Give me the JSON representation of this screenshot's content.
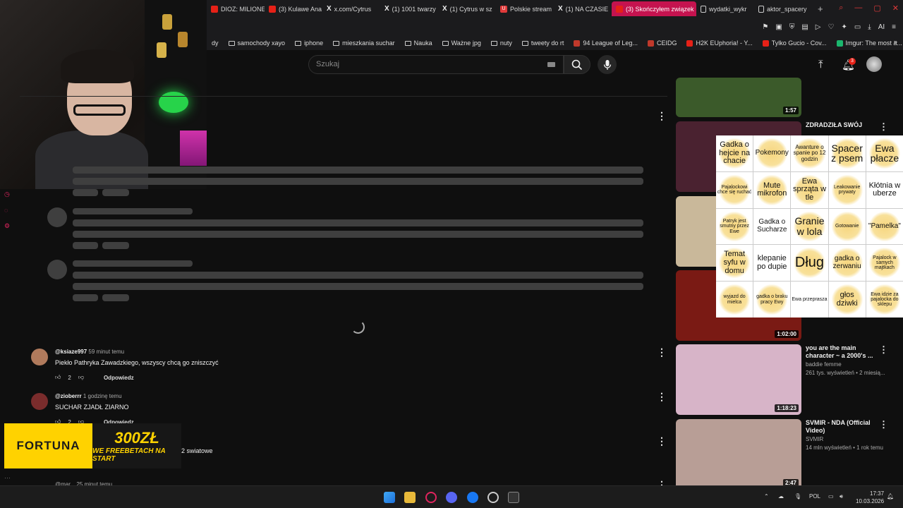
{
  "browser": {
    "tabs": [
      {
        "label": "DIOZ: MILIONE",
        "icon": "youtube-icon"
      },
      {
        "label": "(3) Kulawe Ana",
        "icon": "youtube-icon"
      },
      {
        "label": "x.com/Cytrus",
        "icon": "x-icon"
      },
      {
        "label": "(1) 1001 twarzy",
        "icon": "x-icon"
      },
      {
        "label": "(1) Cytrus w sz",
        "icon": "x-icon"
      },
      {
        "label": "Polskie stream",
        "icon": "u-icon"
      },
      {
        "label": "(1) NA CZASIE",
        "icon": "x-icon"
      },
      {
        "label": "(3) Skończyłem związek",
        "icon": "youtube-icon",
        "active": true
      },
      {
        "label": "wydatki_wykr",
        "icon": "doc-icon"
      },
      {
        "label": "aktor_spacery",
        "icon": "doc-icon"
      }
    ],
    "new_tab": "+",
    "toolbar_ai": "AI",
    "bookmarks": [
      {
        "label": "dy",
        "icon": ""
      },
      {
        "label": "samochody xayo",
        "icon": "folder-icon"
      },
      {
        "label": "iphone",
        "icon": "folder-icon"
      },
      {
        "label": "mieszkania suchar",
        "icon": "folder-icon"
      },
      {
        "label": "Nauka",
        "icon": "folder-icon"
      },
      {
        "label": "Ważne jpg",
        "icon": "folder-icon"
      },
      {
        "label": "nuty",
        "icon": "folder-icon"
      },
      {
        "label": "tweety do rt",
        "icon": "folder-icon"
      },
      {
        "label": "94 League of Leg...",
        "icon": "lol-icon"
      },
      {
        "label": "CEIDG",
        "icon": "ceidg-icon"
      },
      {
        "label": "H2K EUphoria! - Y...",
        "icon": "youtube-icon"
      },
      {
        "label": "Tylko Gucio - Cov...",
        "icon": "youtube-icon"
      },
      {
        "label": "Imgur: The most a...",
        "icon": "imgur-icon"
      }
    ]
  },
  "youtube": {
    "search_placeholder": "Szukaj",
    "notifications_count": "3"
  },
  "comments": [
    {
      "user": "@ksiaze997",
      "time": "59 minut temu",
      "text": "Piekło Pathryka Zawadzkiego, wszyscy chcą go zniszczyć",
      "likes": "2",
      "reply": "Odpowiedz",
      "avatar_color": "#b07a5c"
    },
    {
      "user": "@zioberrr",
      "time": "1 godzinę temu",
      "text": "SUCHAR ZJADŁ ZIARNO",
      "likes": "2",
      "reply": "Odpowiedz",
      "avatar_color": "#7a2c2c"
    },
    {
      "user": "",
      "time": "",
      "text": "2 swiatowe",
      "likes": "",
      "reply": "",
      "avatar_color": "#444"
    },
    {
      "user": "@mar...",
      "time": "25 minut temu",
      "text": "",
      "likes": "",
      "reply": "",
      "avatar_color": "#444"
    }
  ],
  "related": [
    {
      "title": "",
      "channel": "",
      "meta": "",
      "duration": "1:57",
      "thumb": "#3b5a2a"
    },
    {
      "title": "ZDRADZIŁA SWÓJ",
      "channel": "",
      "meta": "",
      "duration": "",
      "thumb": "#4a2230"
    },
    {
      "title": "",
      "channel": "",
      "meta": "",
      "duration": "",
      "thumb": "#c9b89a"
    },
    {
      "title": "",
      "channel": "",
      "meta": "",
      "duration": "1:02:00",
      "thumb": "#7a1a14"
    },
    {
      "title": "you are the main character ~ a 2000's ...",
      "channel": "baddie femme",
      "meta": "261 tys. wyświetleń • 2 miesią...",
      "duration": "1:18:23",
      "thumb": "#d7b4c8"
    },
    {
      "title": "SVMIR - NDA (Official Video)",
      "channel": "SVMIR",
      "meta": "14 mln wyświetleń • 1 rok temu",
      "duration": "2:47",
      "thumb": "#b89e96"
    }
  ],
  "bingo": [
    {
      "text": "Gadka o hejcie na chacie",
      "size": "m",
      "marked": true
    },
    {
      "text": "Pokemony",
      "size": "",
      "marked": true
    },
    {
      "text": "Awanture o spanie po 12 godzin",
      "size": "s2",
      "marked": true
    },
    {
      "text": "Spacer z psem",
      "size": "l",
      "marked": true
    },
    {
      "text": "Ewa płacze",
      "size": "l",
      "marked": true
    },
    {
      "text": "Pajalockowi chce się ruchać",
      "size": "s",
      "marked": true
    },
    {
      "text": "Mute mikrofon",
      "size": "m",
      "marked": true
    },
    {
      "text": "Ewa sprząta w tle",
      "size": "m",
      "marked": true
    },
    {
      "text": "Leakowanie prywaty",
      "size": "s",
      "marked": true
    },
    {
      "text": "Kłótnia w uberze",
      "size": "m",
      "marked": false
    },
    {
      "text": "Patryk jest smutny przez Ewe",
      "size": "s",
      "marked": true
    },
    {
      "text": "Gadka o Sucharze",
      "size": "",
      "marked": false
    },
    {
      "text": "Granie w lola",
      "size": "l",
      "marked": true
    },
    {
      "text": "Gotowanie",
      "size": "s",
      "marked": true
    },
    {
      "text": "\"Pamelka\"",
      "size": "",
      "marked": true
    },
    {
      "text": "Temat syfu w domu",
      "size": "m",
      "marked": true
    },
    {
      "text": "klepanie po dupie",
      "size": "m",
      "marked": false
    },
    {
      "text": "Dług",
      "size": "xl",
      "marked": true
    },
    {
      "text": "gadka o zerwaniu",
      "size": "",
      "marked": true
    },
    {
      "text": "Pajalock w samych majtkach",
      "size": "s",
      "marked": true
    },
    {
      "text": "wyjazd do mielca",
      "size": "s",
      "marked": true
    },
    {
      "text": "gadka o braku pracy Ewy",
      "size": "s",
      "marked": true
    },
    {
      "text": "Ewa przeprasza",
      "size": "s",
      "marked": false
    },
    {
      "text": "głos dziwki",
      "size": "m",
      "marked": true
    },
    {
      "text": "Ewa idzie za pajalocka do sklepu",
      "size": "s",
      "marked": true
    }
  ],
  "ad": {
    "brand": "FORTUNA",
    "amount": "300ZŁ",
    "slogan": "WE FREEBETACH NA START"
  },
  "taskbar": {
    "lang": "POL",
    "time": "17:37",
    "date": "10.03.2026"
  }
}
